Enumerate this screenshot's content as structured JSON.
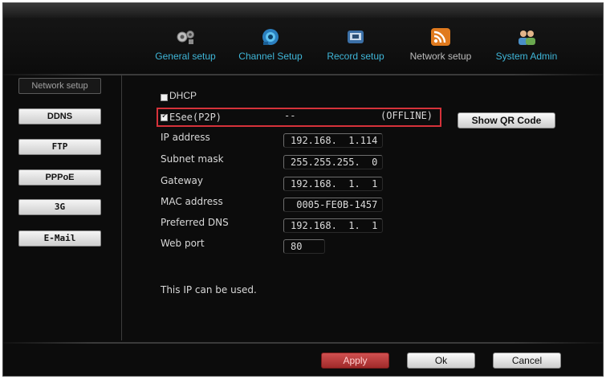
{
  "colors": {
    "tab_active": "#3fb6d8",
    "tab_inactive": "#bcbcbc",
    "highlight": "#d6323a",
    "apply": "#c03a3a"
  },
  "tabs": [
    {
      "label": "General setup",
      "icon": "gears-icon",
      "active": true
    },
    {
      "label": "Channel Setup",
      "icon": "camera-icon",
      "active": true
    },
    {
      "label": "Record setup",
      "icon": "recorder-icon",
      "active": true
    },
    {
      "label": "Network setup",
      "icon": "wifi-icon",
      "active": false
    },
    {
      "label": "System Admin",
      "icon": "users-icon",
      "active": true
    }
  ],
  "sidebar": [
    {
      "label": "Network setup",
      "active": true
    },
    {
      "label": "DDNS"
    },
    {
      "label": "FTP"
    },
    {
      "label": "PPPoE"
    },
    {
      "label": "3G"
    },
    {
      "label": "E-Mail"
    }
  ],
  "form": {
    "dhcp": {
      "label": "DHCP",
      "checked": false
    },
    "esee": {
      "label": "ESee(P2P)",
      "checked": true,
      "value": "--",
      "status": "(OFFLINE)"
    },
    "show_qr_label": "Show QR Code",
    "fields": [
      {
        "label": "IP address",
        "value": "192.168.  1.114"
      },
      {
        "label": "Subnet mask",
        "value": "255.255.255.  0"
      },
      {
        "label": "Gateway",
        "value": "192.168.  1.  1"
      },
      {
        "label": "MAC address",
        "value": " 0005-FE0B-1457"
      },
      {
        "label": "Preferred DNS",
        "value": "192.168.  1.  1"
      },
      {
        "label": "Web port",
        "value": "80"
      }
    ],
    "status_message": "This IP can be used."
  },
  "footer": {
    "apply": "Apply",
    "ok": "Ok",
    "cancel": "Cancel"
  }
}
